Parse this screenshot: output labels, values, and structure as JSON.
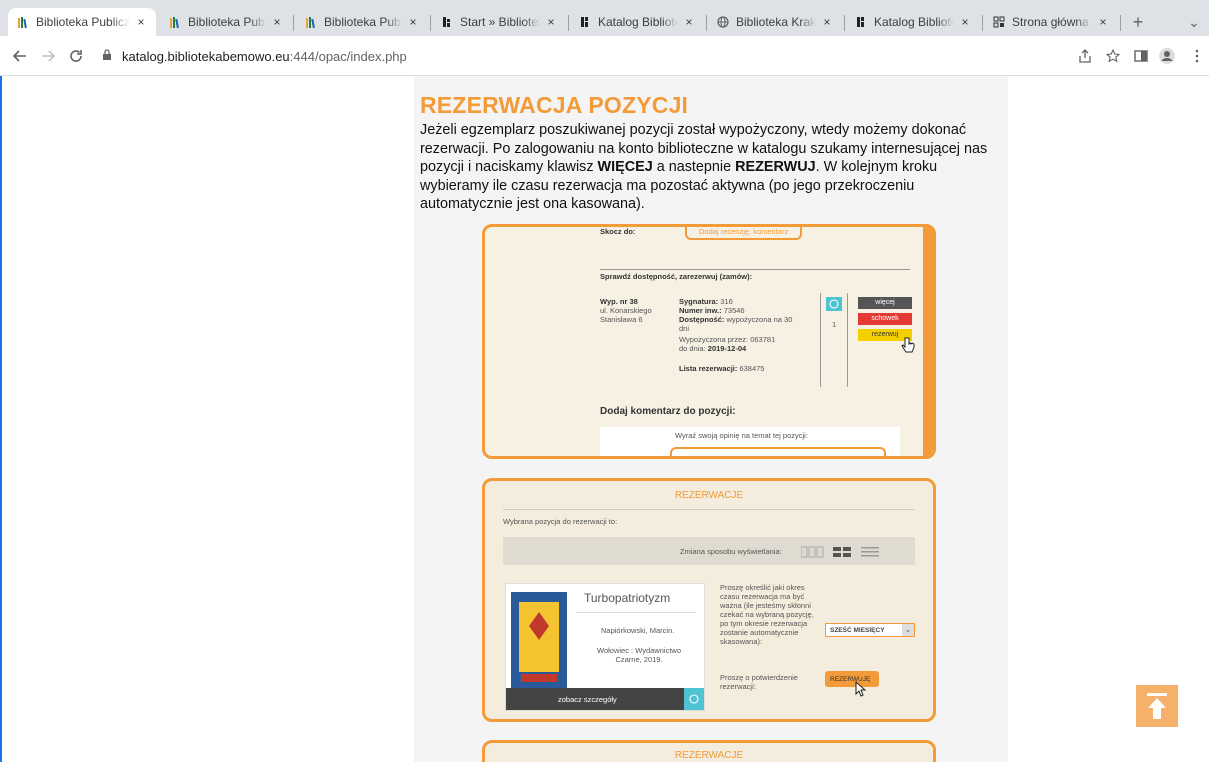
{
  "browser": {
    "tabs": [
      {
        "title": "Biblioteka Publiczna",
        "favicon": "library-books-icon",
        "active": true
      },
      {
        "title": "Biblioteka Publiczna",
        "favicon": "library-books-icon"
      },
      {
        "title": "Biblioteka Publiczna",
        "favicon": "library-books-icon"
      },
      {
        "title": "Start » Biblioteka",
        "favicon": "b-logo-icon"
      },
      {
        "title": "Katalog Biblioteki",
        "favicon": "b-logo-icon"
      },
      {
        "title": "Biblioteka Kraków",
        "favicon": "globe-icon"
      },
      {
        "title": "Katalog Biblioteki",
        "favicon": "b-logo-icon"
      },
      {
        "title": "Strona główna - W",
        "favicon": "grid-logo-icon"
      }
    ],
    "new_tab": "+",
    "tab_menu": "⌄",
    "close": "×",
    "url_host": "katalog.bibliotekabemowo.eu",
    "url_path": ":444/opac/index.php"
  },
  "page": {
    "heading": "REZERWACJA POZYCJI",
    "intro_1": "Jeżeli egzemplarz poszukiwanej pozycji został wypożyczony, wtedy możemy dokonać rezerwacji. Po zalogowaniu na konto biblioteczne w katalogu szukamy internesującej nas pozycji i naciskamy klawisz ",
    "intro_b1": "WIĘCEJ",
    "intro_2": " a nastepnie ",
    "intro_b2": "REZERWUJ",
    "intro_3": ". W kolejnym kroku wybieramy ile czasu rezerwacja ma pozostać aktywna (po jego przekroczeniu automatycznie jest ona kasowana)."
  },
  "shot1": {
    "skocz": "Skocz do:",
    "skocz_btn": "Dodaj recenzję, komentarz",
    "section": "Sprawdź dostępność, zarezerwuj (zamów):",
    "branch": "Wyp. nr 38",
    "addr1": "ul. Konarskiego",
    "addr2": "Stanisława 6",
    "sig_l": "Sygnatura:",
    "sig_v": "316",
    "inw_l": "Numer inw.:",
    "inw_v": "73546",
    "dost_l": "Dostępność:",
    "dost_v": "wypożyczona na 30",
    "dost_v2": "dni",
    "wyp_przez": "Wypożyczona przez: 063781",
    "do_dnia_l": "do dnia:",
    "do_dnia_v": "2019-12-04",
    "lista_l": "Lista rezerwacji:",
    "lista_v": "638475",
    "count": "1",
    "btn_wiecej": "więcej",
    "btn_schowek": "schowek",
    "btn_rezerwuj": "rezerwuj",
    "comment_title": "Dodaj komentarz do pozycji:",
    "comment_prompt": "Wyraź swoją opinię na temat tej pozycji:"
  },
  "shot2": {
    "title": "REZERWACJE",
    "chosen": "Wybrana pozycja do rezerwacji to:",
    "view_label": "Zmiana sposobu wyświetlania:",
    "book_title": "Turbopatriotyzm",
    "author": "Napiórkowski, Marcin.",
    "publisher": "Wołowiec : Wydawnictwo Czarne, 2019.",
    "details": "zobacz szczegóły",
    "instr": "Proszę określić jaki okres czasu rezerwacja ma być ważna (ile jesteśmy skłonni czekać na wybraną pozycję, po tym okresie rezerwacja zostanie automatycznie skasowana):",
    "period": "SZEŚĆ MIESIĘCY",
    "confirm": "Proszę o potwierdzenie rezerwacji:",
    "btn": "REZERWUJĘ"
  },
  "shot3": {
    "title": "REZERWACJE"
  },
  "colors": {
    "accent": "#f29b38",
    "teal": "#4fc3d1"
  }
}
